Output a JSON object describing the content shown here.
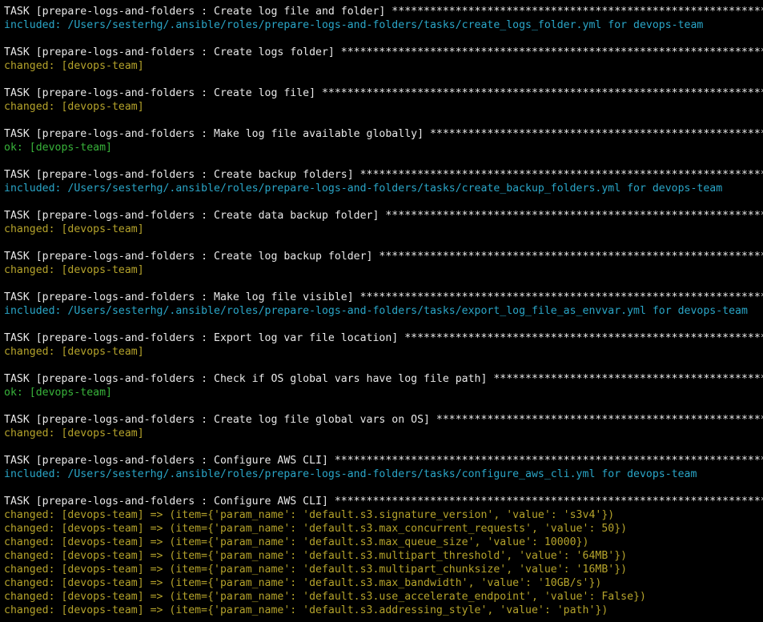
{
  "colors": {
    "background": "#000000",
    "task": "#e8e8e8",
    "included": "#2aa6c8",
    "changed": "#b5a32b",
    "ok": "#38b33a"
  },
  "lines": [
    {
      "kind": "task",
      "text": "TASK [prepare-logs-and-folders : Create log file and folder] ************************************************************************"
    },
    {
      "kind": "included",
      "text": "included: /Users/sesterhg/.ansible/roles/prepare-logs-and-folders/tasks/create_logs_folder.yml for devops-team"
    },
    {
      "kind": "blank",
      "text": ""
    },
    {
      "kind": "task",
      "text": "TASK [prepare-logs-and-folders : Create logs folder] ********************************************************************************"
    },
    {
      "kind": "changed",
      "text": "changed: [devops-team]"
    },
    {
      "kind": "blank",
      "text": ""
    },
    {
      "kind": "task",
      "text": "TASK [prepare-logs-and-folders : Create log file] ***********************************************************************************"
    },
    {
      "kind": "changed",
      "text": "changed: [devops-team]"
    },
    {
      "kind": "blank",
      "text": ""
    },
    {
      "kind": "task",
      "text": "TASK [prepare-logs-and-folders : Make log file available globally] ******************************************************************"
    },
    {
      "kind": "ok",
      "text": "ok: [devops-team]"
    },
    {
      "kind": "blank",
      "text": ""
    },
    {
      "kind": "task",
      "text": "TASK [prepare-logs-and-folders : Create backup folders] *****************************************************************************"
    },
    {
      "kind": "included",
      "text": "included: /Users/sesterhg/.ansible/roles/prepare-logs-and-folders/tasks/create_backup_folders.yml for devops-team"
    },
    {
      "kind": "blank",
      "text": ""
    },
    {
      "kind": "task",
      "text": "TASK [prepare-logs-and-folders : Create data backup folder] *************************************************************************"
    },
    {
      "kind": "changed",
      "text": "changed: [devops-team]"
    },
    {
      "kind": "blank",
      "text": ""
    },
    {
      "kind": "task",
      "text": "TASK [prepare-logs-and-folders : Create log backup folder] **************************************************************************"
    },
    {
      "kind": "changed",
      "text": "changed: [devops-team]"
    },
    {
      "kind": "blank",
      "text": ""
    },
    {
      "kind": "task",
      "text": "TASK [prepare-logs-and-folders : Make log file visible] *****************************************************************************"
    },
    {
      "kind": "included",
      "text": "included: /Users/sesterhg/.ansible/roles/prepare-logs-and-folders/tasks/export_log_file_as_envvar.yml for devops-team"
    },
    {
      "kind": "blank",
      "text": ""
    },
    {
      "kind": "task",
      "text": "TASK [prepare-logs-and-folders : Export log var file location] **********************************************************************"
    },
    {
      "kind": "changed",
      "text": "changed: [devops-team]"
    },
    {
      "kind": "blank",
      "text": ""
    },
    {
      "kind": "task",
      "text": "TASK [prepare-logs-and-folders : Check if OS global vars have log file path] ********************************************************"
    },
    {
      "kind": "ok",
      "text": "ok: [devops-team]"
    },
    {
      "kind": "blank",
      "text": ""
    },
    {
      "kind": "task",
      "text": "TASK [prepare-logs-and-folders : Create log file global vars on OS] *****************************************************************"
    },
    {
      "kind": "changed",
      "text": "changed: [devops-team]"
    },
    {
      "kind": "blank",
      "text": ""
    },
    {
      "kind": "task",
      "text": "TASK [prepare-logs-and-folders : Configure AWS CLI] *********************************************************************************"
    },
    {
      "kind": "included",
      "text": "included: /Users/sesterhg/.ansible/roles/prepare-logs-and-folders/tasks/configure_aws_cli.yml for devops-team"
    },
    {
      "kind": "blank",
      "text": ""
    },
    {
      "kind": "task",
      "text": "TASK [prepare-logs-and-folders : Configure AWS CLI] *********************************************************************************"
    },
    {
      "kind": "changed",
      "text": "changed: [devops-team] => (item={'param_name': 'default.s3.signature_version', 'value': 's3v4'})"
    },
    {
      "kind": "changed",
      "text": "changed: [devops-team] => (item={'param_name': 'default.s3.max_concurrent_requests', 'value': 50})"
    },
    {
      "kind": "changed",
      "text": "changed: [devops-team] => (item={'param_name': 'default.s3.max_queue_size', 'value': 10000})"
    },
    {
      "kind": "changed",
      "text": "changed: [devops-team] => (item={'param_name': 'default.s3.multipart_threshold', 'value': '64MB'})"
    },
    {
      "kind": "changed",
      "text": "changed: [devops-team] => (item={'param_name': 'default.s3.multipart_chunksize', 'value': '16MB'})"
    },
    {
      "kind": "changed",
      "text": "changed: [devops-team] => (item={'param_name': 'default.s3.max_bandwidth', 'value': '10GB/s'})"
    },
    {
      "kind": "changed",
      "text": "changed: [devops-team] => (item={'param_name': 'default.s3.use_accelerate_endpoint', 'value': False})"
    },
    {
      "kind": "changed",
      "text": "changed: [devops-team] => (item={'param_name': 'default.s3.addressing_style', 'value': 'path'})"
    }
  ]
}
